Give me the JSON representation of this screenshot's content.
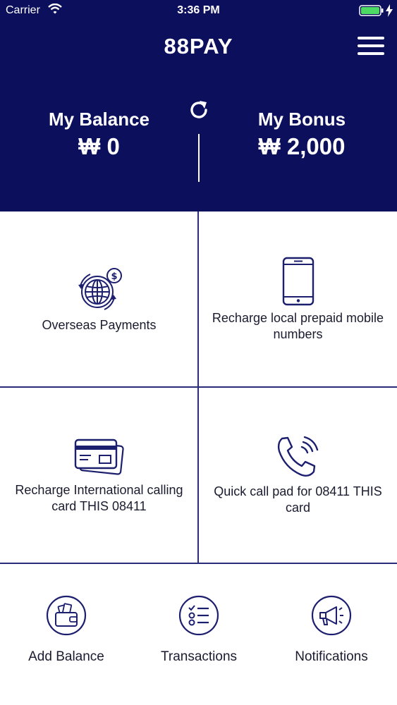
{
  "status_bar": {
    "carrier": "Carrier",
    "time": "3:36 PM"
  },
  "header": {
    "title": "88PAY",
    "balance": {
      "label": "My Balance",
      "value": "₩ 0"
    },
    "bonus": {
      "label": "My Bonus",
      "value": "₩ 2,000"
    }
  },
  "services": [
    {
      "label": "Overseas Payments",
      "icon": "globe-dollar-icon"
    },
    {
      "label": "Recharge local prepaid mobile numbers",
      "icon": "smartphone-icon"
    },
    {
      "label": "Recharge International calling card THIS 08411",
      "icon": "credit-card-icon"
    },
    {
      "label": "Quick call pad for 08411 THIS card",
      "icon": "phone-call-icon"
    }
  ],
  "bottom_nav": [
    {
      "label": "Add Balance",
      "icon": "wallet-icon"
    },
    {
      "label": "Transactions",
      "icon": "checklist-icon"
    },
    {
      "label": "Notifications",
      "icon": "megaphone-icon"
    }
  ],
  "colors": {
    "header_bg": "#0b0f5c",
    "accent": "#1c1e6e",
    "battery": "#4cd964"
  }
}
